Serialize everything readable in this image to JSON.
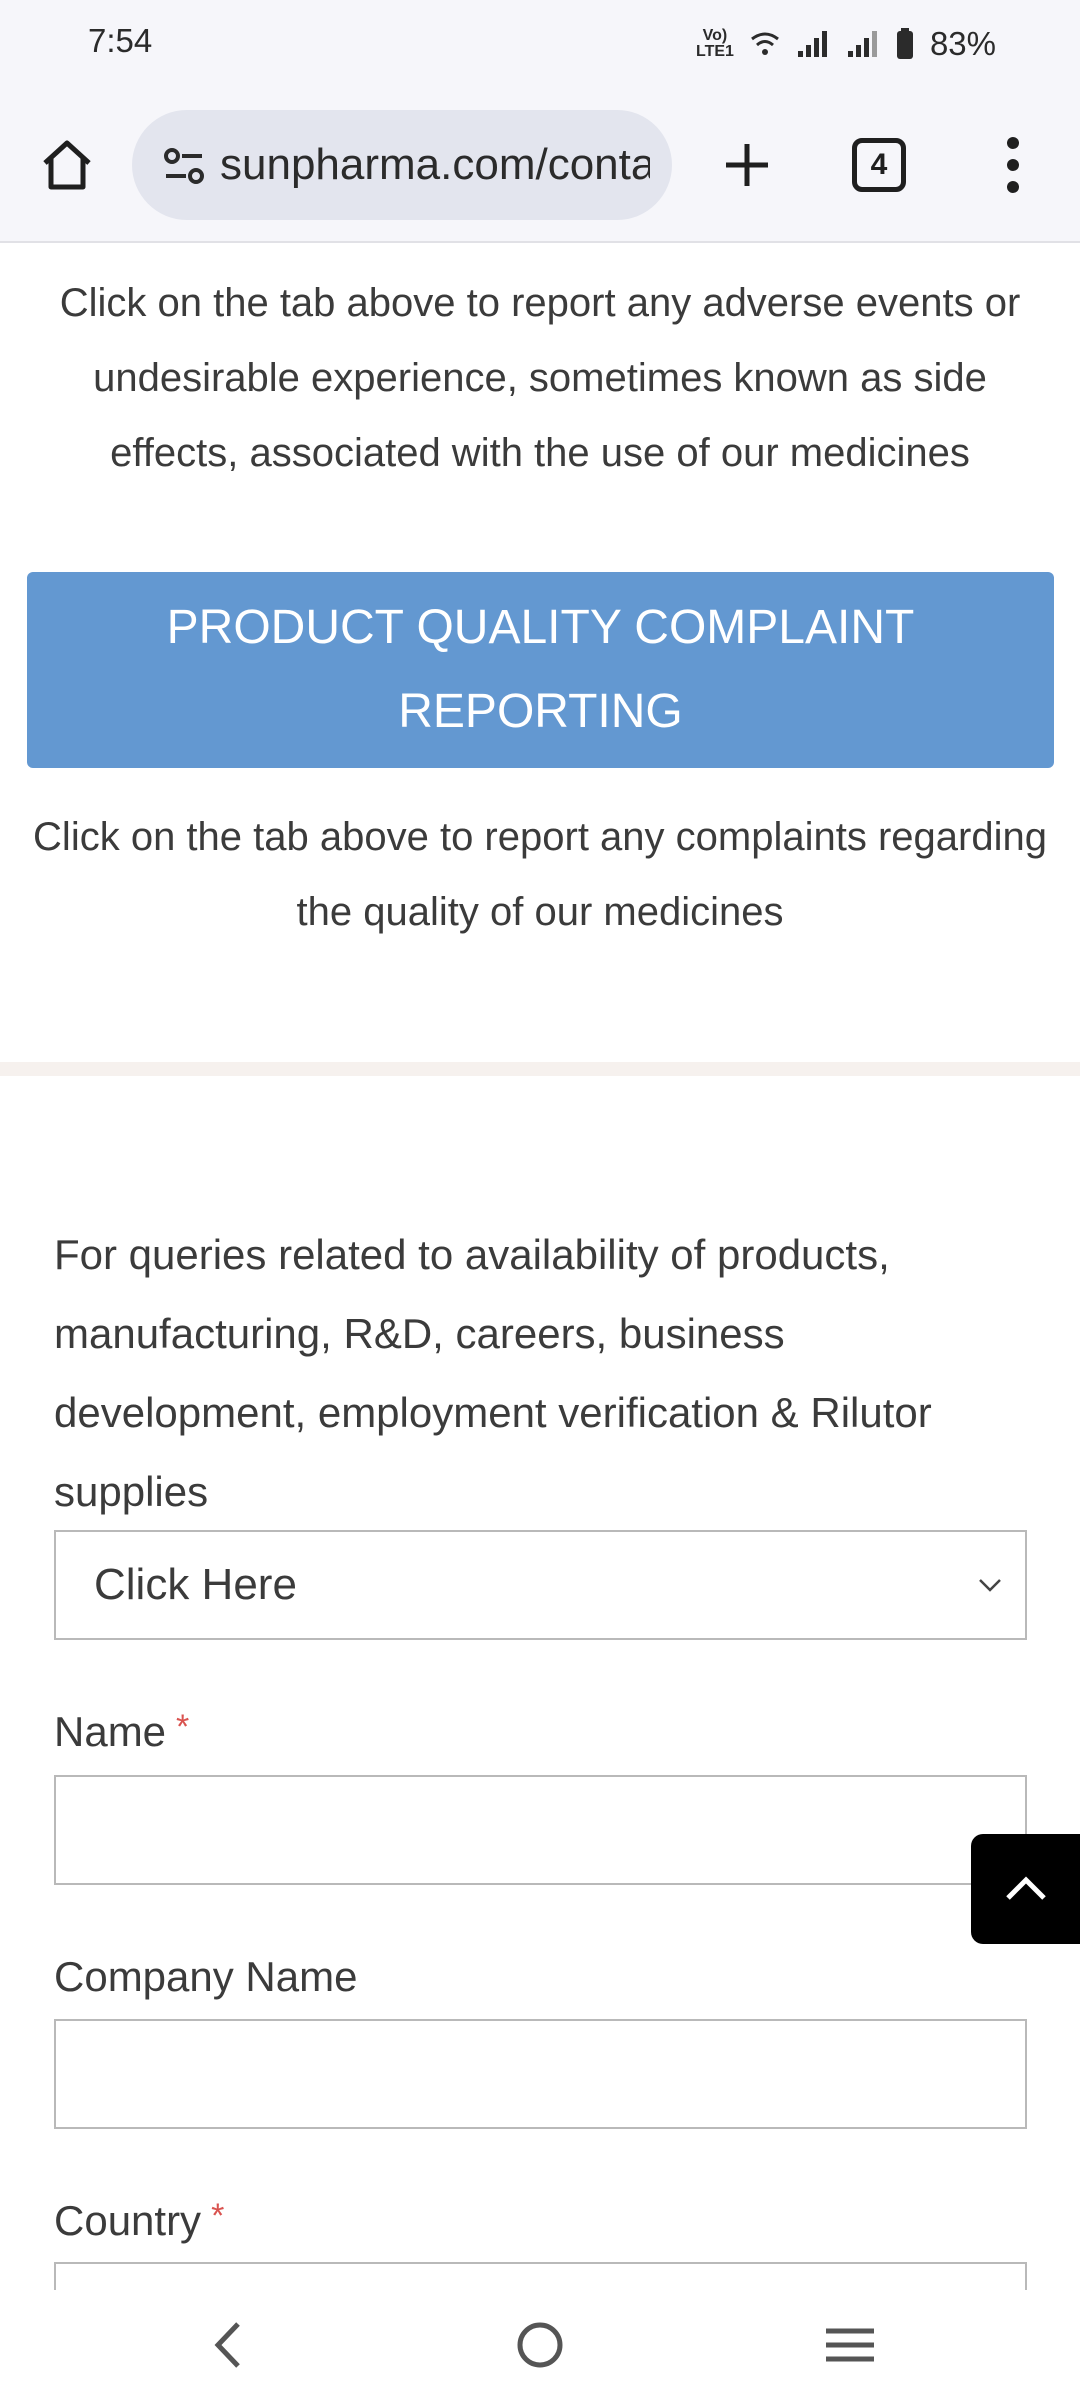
{
  "status_bar": {
    "time": "7:54",
    "battery": "83%",
    "icons": [
      "volte-icon",
      "wifi-icon",
      "signal-icon",
      "signal-icon",
      "battery-icon"
    ]
  },
  "browser": {
    "url": "sunpharma.com/conta",
    "tab_count": "4"
  },
  "content": {
    "adverse_text": "Click on the tab above to report any adverse events or undesirable experience, sometimes known as side effects, associated with the use of our medicines",
    "pqc_button_label": "PRODUCT QUALITY COMPLAINT REPORTING",
    "pqc_text": "Click on the tab above to report any complaints regarding the quality of our medicines",
    "queries_text": "For queries related to availability of products, manufacturing, R&D, careers, business development, employment verification & Rilutor supplies"
  },
  "form": {
    "select_value": "Click Here",
    "name_label": "Name",
    "company_label": "Company Name",
    "country_label": "Country",
    "required_mark": "*"
  },
  "colors": {
    "button_blue": "#6398d1",
    "required_red": "#d9534f"
  }
}
